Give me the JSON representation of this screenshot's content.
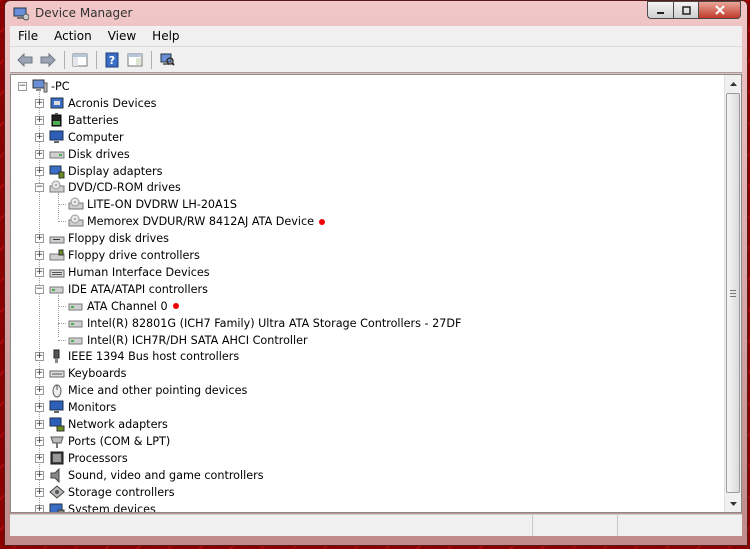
{
  "window": {
    "title": "Device Manager"
  },
  "menu": [
    {
      "label": "File"
    },
    {
      "label": "Action"
    },
    {
      "label": "View"
    },
    {
      "label": "Help"
    }
  ],
  "toolbar": {
    "buttons": [
      "back-arrow-icon",
      "forward-arrow-icon",
      "console-tree-icon",
      "help-icon",
      "properties-icon",
      "scan-hardware-icon"
    ]
  },
  "tree": {
    "root": {
      "label": "-PC",
      "icon": "computer-icon"
    },
    "items": [
      {
        "label": "Acronis Devices",
        "icon": "acronis-icon",
        "expanded": false,
        "level": 1
      },
      {
        "label": "Batteries",
        "icon": "battery-icon",
        "expanded": false,
        "level": 1
      },
      {
        "label": "Computer",
        "icon": "monitor-icon",
        "expanded": false,
        "level": 1
      },
      {
        "label": "Disk drives",
        "icon": "disk-drive-icon",
        "expanded": false,
        "level": 1
      },
      {
        "label": "Display adapters",
        "icon": "display-adapter-icon",
        "expanded": false,
        "level": 1
      },
      {
        "label": "DVD/CD-ROM drives",
        "icon": "dvd-drive-icon",
        "expanded": true,
        "level": 1
      },
      {
        "label": "LITE-ON DVDRW LH-20A1S",
        "icon": "dvd-drive-icon",
        "level": 2
      },
      {
        "label": "Memorex DVDUR/RW 8412AJ ATA Device",
        "icon": "dvd-drive-icon",
        "level": 2,
        "marker": true
      },
      {
        "label": "Floppy disk drives",
        "icon": "floppy-drive-icon",
        "expanded": false,
        "level": 1
      },
      {
        "label": "Floppy drive controllers",
        "icon": "floppy-controller-icon",
        "expanded": false,
        "level": 1
      },
      {
        "label": "Human Interface Devices",
        "icon": "hid-icon",
        "expanded": false,
        "level": 1
      },
      {
        "label": "IDE ATA/ATAPI controllers",
        "icon": "ide-controller-icon",
        "expanded": true,
        "level": 1
      },
      {
        "label": "ATA Channel 0",
        "icon": "ide-controller-icon",
        "level": 2,
        "marker": true
      },
      {
        "label": "Intel(R) 82801G (ICH7 Family) Ultra ATA Storage Controllers - 27DF",
        "icon": "ide-controller-icon",
        "level": 2
      },
      {
        "label": "Intel(R) ICH7R/DH SATA AHCI Controller",
        "icon": "ide-controller-icon",
        "level": 2
      },
      {
        "label": "IEEE 1394 Bus host controllers",
        "icon": "ieee1394-icon",
        "expanded": false,
        "level": 1
      },
      {
        "label": "Keyboards",
        "icon": "keyboard-icon",
        "expanded": false,
        "level": 1
      },
      {
        "label": "Mice and other pointing devices",
        "icon": "mouse-icon",
        "expanded": false,
        "level": 1
      },
      {
        "label": "Monitors",
        "icon": "monitor-icon",
        "expanded": false,
        "level": 1
      },
      {
        "label": "Network adapters",
        "icon": "network-adapter-icon",
        "expanded": false,
        "level": 1
      },
      {
        "label": "Ports (COM & LPT)",
        "icon": "port-icon",
        "expanded": false,
        "level": 1
      },
      {
        "label": "Processors",
        "icon": "processor-icon",
        "expanded": false,
        "level": 1
      },
      {
        "label": "Sound, video and game controllers",
        "icon": "sound-icon",
        "expanded": false,
        "level": 1
      },
      {
        "label": "Storage controllers",
        "icon": "storage-controller-icon",
        "expanded": false,
        "level": 1
      },
      {
        "label": "System devices",
        "icon": "system-device-icon",
        "expanded": false,
        "level": 1
      }
    ]
  },
  "colors": {
    "marker": "#e00000",
    "frame": "#8b0000"
  }
}
